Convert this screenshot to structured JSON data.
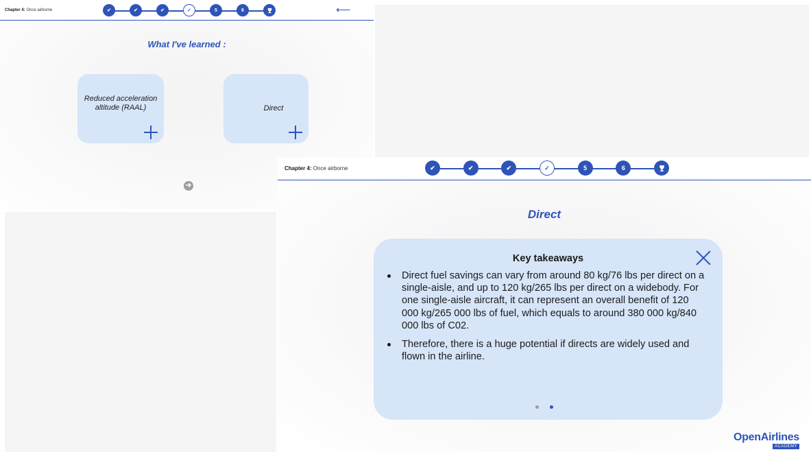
{
  "colors": {
    "accent": "#2e54b8",
    "card": "#d6e5f8",
    "panel_gray": "#f5f5f6",
    "inactive_dot": "#9e9e9e"
  },
  "panel_a": {
    "chapter_label": "Chapter 4:",
    "chapter_name": "Once airborne",
    "steps": [
      {
        "state": "done",
        "glyph": "✔"
      },
      {
        "state": "done",
        "glyph": "✔"
      },
      {
        "state": "done",
        "glyph": "✔"
      },
      {
        "state": "current",
        "glyph": "✓"
      },
      {
        "state": "todo",
        "glyph": "5"
      },
      {
        "state": "todo",
        "glyph": "6"
      },
      {
        "state": "final",
        "glyph": "trophy-icon"
      }
    ],
    "back_icon": "arrow-left-icon",
    "title": "What I've learned :",
    "cards": [
      {
        "label": "Reduced acceleration altitude (RAAL)"
      },
      {
        "label": "Direct"
      }
    ],
    "next_icon": "arrow-right-circle-icon"
  },
  "panel_d": {
    "chapter_label": "Chapter 4:",
    "chapter_name": "Once airborne",
    "steps": [
      {
        "state": "done",
        "glyph": "✔"
      },
      {
        "state": "done",
        "glyph": "✔"
      },
      {
        "state": "done",
        "glyph": "✔"
      },
      {
        "state": "current",
        "glyph": "✓"
      },
      {
        "state": "todo",
        "glyph": "5"
      },
      {
        "state": "todo",
        "glyph": "6"
      },
      {
        "state": "final",
        "glyph": "trophy-icon"
      }
    ],
    "title": "Direct",
    "modal": {
      "heading": "Key takeaways",
      "close_icon": "close-icon",
      "bullets": [
        "Direct fuel savings can vary from around 80 kg/76 lbs per direct on a single-aisle, and up to 120 kg/265 lbs per direct on a widebody. For one single-aisle aircraft, it can represent an overall benefit of 120 000 kg/265 000 lbs of fuel, which equals to around 380 000 kg/840 000 lbs of C02.",
        "Therefore, there is a huge potential if directs are widely used and flown in the airline."
      ],
      "pagination": {
        "total": 2,
        "current": 2
      }
    }
  },
  "logo": {
    "name": "OpenAirlines",
    "sub": "ACADEMY"
  }
}
